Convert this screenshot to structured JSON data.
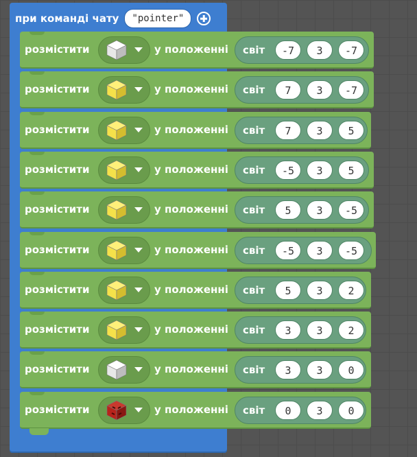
{
  "event": {
    "title": "при команді чату",
    "command": "\"pointer\""
  },
  "labels": {
    "place": "розмістити",
    "at": "у положенні",
    "world": "світ"
  },
  "rows": [
    {
      "block": "white-block",
      "x": "-7",
      "y": "3",
      "z": "-7"
    },
    {
      "block": "gold-block",
      "x": "7",
      "y": "3",
      "z": "-7"
    },
    {
      "block": "gold-block",
      "x": "7",
      "y": "3",
      "z": "5"
    },
    {
      "block": "gold-block",
      "x": "-5",
      "y": "3",
      "z": "5"
    },
    {
      "block": "gold-block",
      "x": "5",
      "y": "3",
      "z": "-5"
    },
    {
      "block": "gold-block",
      "x": "-5",
      "y": "3",
      "z": "-5"
    },
    {
      "block": "gold-block",
      "x": "5",
      "y": "3",
      "z": "2"
    },
    {
      "block": "gold-block",
      "x": "3",
      "y": "3",
      "z": "2"
    },
    {
      "block": "white-block",
      "x": "3",
      "y": "3",
      "z": "0"
    },
    {
      "block": "redstone-block",
      "x": "0",
      "y": "3",
      "z": "0"
    }
  ],
  "colors": {
    "event_blue": "#3e7ed0",
    "block_green": "#7cb35a",
    "world_teal": "#6aa07f",
    "gold": "#f5e14a",
    "white_block": "#e8e8e8",
    "redstone": "#b8231b"
  }
}
